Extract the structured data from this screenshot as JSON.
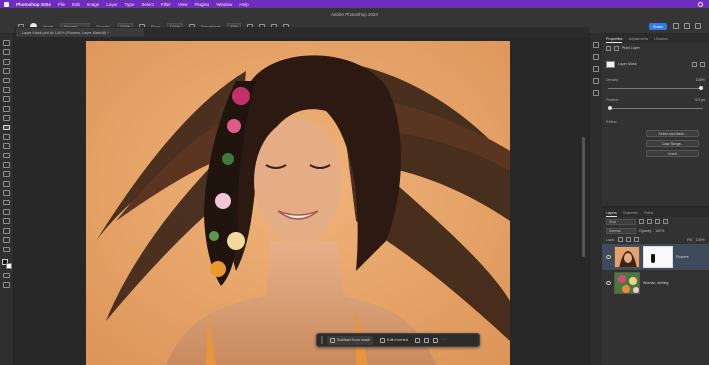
{
  "menubar": {
    "app_name": "Photoshop 2024",
    "items": [
      "File",
      "Edit",
      "Image",
      "Layer",
      "Type",
      "Select",
      "Filter",
      "View",
      "Plugins",
      "Window",
      "Help"
    ]
  },
  "options_bar": {
    "window_title": "Adobe Photoshop 2024",
    "mode_label": "Mode:",
    "mode_value": "Normal",
    "opacity_label": "Opacity:",
    "opacity_value": "100%",
    "flow_label": "Flow:",
    "flow_value": "100%",
    "smoothing_label": "Smoothing:",
    "smoothing_value": "10%",
    "share_label": "Share"
  },
  "document_tab": {
    "title": "Layer Mask.psd @ 100% (Flowers, Layer Mask/8) *"
  },
  "canvas": {
    "background_color": "#e9a66c"
  },
  "contextual_taskbar": {
    "primary_label": "Subtract from mask",
    "secondary_label": "Edit inverted",
    "more_label": "···"
  },
  "properties_panel": {
    "tabs": [
      "Properties",
      "Adjustments",
      "Libraries"
    ],
    "header": "Pixel Layer",
    "layer_label": "Layer Mask",
    "density_label": "Density:",
    "density_value": "100%",
    "feather_label": "Feather:",
    "feather_value": "0.0 px",
    "density_fraction": 1.0,
    "feather_fraction": 0.0,
    "refine_label": "Refine:",
    "buttons": [
      "Select and Mask...",
      "Color Range...",
      "Invert"
    ]
  },
  "layers_panel": {
    "tabs": [
      "Layers",
      "Channels",
      "Paths"
    ],
    "kind_label": "Kind",
    "blend_mode": "Normal",
    "opacity_label": "Opacity:",
    "opacity_value": "100%",
    "lock_label": "Lock:",
    "fill_label": "Fill:",
    "fill_value": "100%",
    "layers": [
      {
        "name": "Flowers",
        "selected": true,
        "has_mask": true
      },
      {
        "name": "Woman, smiling",
        "selected": false,
        "has_mask": false
      }
    ]
  },
  "colors": {
    "menubar": "#6f2dbd",
    "accent": "#2f7ce8",
    "canvas_bg": "#e9a66c"
  }
}
